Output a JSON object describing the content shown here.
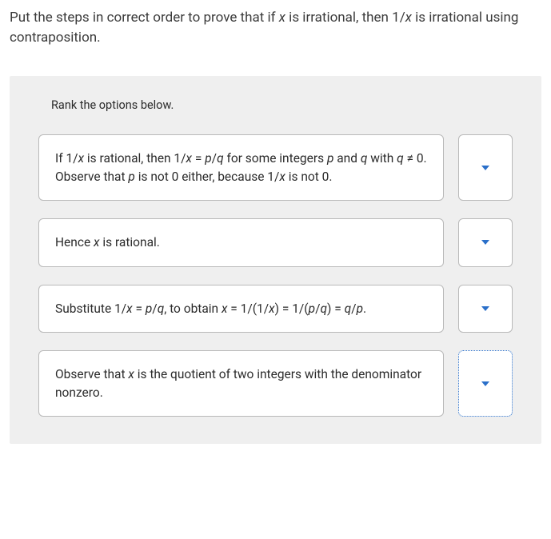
{
  "question": {
    "pre1": "Put the steps in correct order to prove that if ",
    "x1": "x",
    "mid1": " is irrational, then 1/",
    "x2": "x",
    "post1": " is irrational using contraposition."
  },
  "instruction": "Rank the options below.",
  "options": [
    {
      "a": "If 1/",
      "b": "x",
      "c": " is rational, then 1/",
      "d": "x",
      "e": " = ",
      "f": "p",
      "g": "/",
      "h": "q",
      "i": " for some integers ",
      "j": "p",
      "k": " and ",
      "l": "q",
      "m": " with ",
      "n": "q",
      "o": " ≠ 0. Observe that ",
      "p": "p",
      "q": " is not 0 either, because 1/",
      "r": "x",
      "s": " is not 0.",
      "focused": false
    },
    {
      "a": "Hence ",
      "b": "x",
      "c": " is rational.",
      "focused": false
    },
    {
      "a": "Substitute 1/",
      "b": "x",
      "c": " = ",
      "d": "p",
      "e": "/",
      "f": "q",
      "g": ", to obtain ",
      "h": "x",
      "i": " = 1/(1/",
      "j": "x",
      "k": ") = 1/(",
      "l": "p",
      "m": "/",
      "n": "q",
      "o": ") = ",
      "p": "q",
      "q": "/",
      "r": "p",
      "s": ".",
      "focused": false
    },
    {
      "a": "Observe that ",
      "b": "x",
      "c": " is the quotient of two integers with the denominator nonzero.",
      "focused": true
    }
  ]
}
